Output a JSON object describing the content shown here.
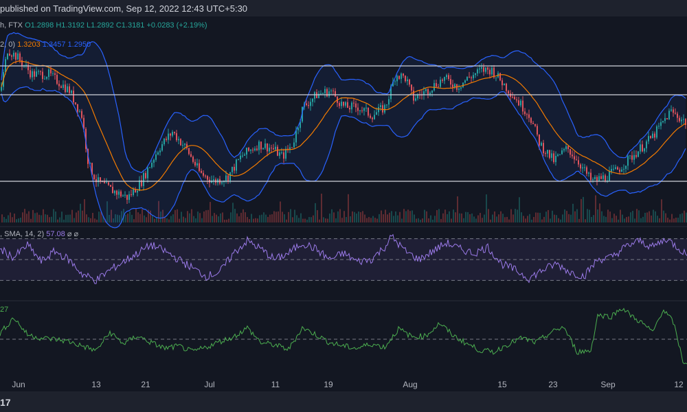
{
  "header": {
    "published_text": "published on TradingView.com, Sep 12, 2022 12:43 UTC+5:30"
  },
  "main_legend": {
    "prefix": "h, FTX",
    "o": "O1.2898",
    "h": "H1.3192",
    "l": "L1.2892",
    "c": "C1.3181",
    "chg": "+0.0283 (+2.19%)"
  },
  "bb_legend": {
    "params": "2, 0)",
    "basis": "1.3203",
    "upper": "1.3457",
    "lower": "1.2950"
  },
  "rsi_legend": {
    "params": ", SMA, 14, 2)",
    "value": "57.08",
    "extra": "⌀  ⌀"
  },
  "third_legend": {
    "value": "27"
  },
  "x_axis": {
    "labels": [
      "Jun",
      "13",
      "21",
      "Jul",
      "11",
      "19",
      "Aug",
      "15",
      "23",
      "Sep",
      "12"
    ]
  },
  "footer": {
    "logo": "17"
  },
  "colors": {
    "up": "#26a69a",
    "down": "#ef5350",
    "bb_band": "#2962ff",
    "bb_basis": "#f57c00",
    "rsi": "#9c7bea",
    "third": "#4caf50",
    "hline": "#d1d4dc"
  },
  "chart_data": [
    {
      "type": "candlestick",
      "title": "",
      "indicators": [
        "Bollinger Bands",
        "Volume"
      ],
      "price_path": [
        [
          0,
          1.31
        ],
        [
          10,
          1.36
        ],
        [
          25,
          1.35
        ],
        [
          45,
          1.33
        ],
        [
          70,
          1.33
        ],
        [
          100,
          1.31
        ],
        [
          118,
          1.28
        ],
        [
          128,
          1.22
        ],
        [
          140,
          1.2
        ],
        [
          160,
          1.19
        ],
        [
          185,
          1.18
        ],
        [
          205,
          1.2
        ],
        [
          230,
          1.24
        ],
        [
          250,
          1.26
        ],
        [
          270,
          1.24
        ],
        [
          290,
          1.21
        ],
        [
          310,
          1.2
        ],
        [
          330,
          1.205
        ],
        [
          350,
          1.23
        ],
        [
          375,
          1.245
        ],
        [
          395,
          1.24
        ],
        [
          410,
          1.23
        ],
        [
          425,
          1.245
        ],
        [
          440,
          1.29
        ],
        [
          460,
          1.305
        ],
        [
          480,
          1.31
        ],
        [
          500,
          1.29
        ],
        [
          520,
          1.29
        ],
        [
          540,
          1.28
        ],
        [
          560,
          1.29
        ],
        [
          575,
          1.33
        ],
        [
          590,
          1.325
        ],
        [
          600,
          1.3
        ],
        [
          620,
          1.31
        ],
        [
          645,
          1.325
        ],
        [
          665,
          1.315
        ],
        [
          680,
          1.325
        ],
        [
          700,
          1.335
        ],
        [
          715,
          1.335
        ],
        [
          730,
          1.32
        ],
        [
          750,
          1.3
        ],
        [
          770,
          1.28
        ],
        [
          785,
          1.245
        ],
        [
          805,
          1.225
        ],
        [
          825,
          1.24
        ],
        [
          840,
          1.225
        ],
        [
          860,
          1.2
        ],
        [
          880,
          1.205
        ],
        [
          900,
          1.215
        ],
        [
          925,
          1.235
        ],
        [
          950,
          1.255
        ],
        [
          975,
          1.285
        ],
        [
          1000,
          1.27
        ]
      ],
      "horizontal_lines": [
        1.34,
        1.305,
        1.2
      ]
    },
    {
      "type": "line",
      "title": "RSI",
      "value": 57.08,
      "levels": [
        70,
        50,
        30
      ],
      "values_path": [
        [
          0,
          60
        ],
        [
          20,
          52
        ],
        [
          40,
          64
        ],
        [
          60,
          48
        ],
        [
          80,
          58
        ],
        [
          100,
          50
        ],
        [
          120,
          36
        ],
        [
          140,
          30
        ],
        [
          160,
          40
        ],
        [
          180,
          48
        ],
        [
          200,
          56
        ],
        [
          220,
          64
        ],
        [
          240,
          58
        ],
        [
          260,
          50
        ],
        [
          280,
          42
        ],
        [
          300,
          34
        ],
        [
          320,
          38
        ],
        [
          340,
          56
        ],
        [
          360,
          68
        ],
        [
          380,
          60
        ],
        [
          400,
          50
        ],
        [
          420,
          56
        ],
        [
          440,
          66
        ],
        [
          460,
          60
        ],
        [
          480,
          50
        ],
        [
          500,
          56
        ],
        [
          520,
          48
        ],
        [
          540,
          50
        ],
        [
          560,
          62
        ],
        [
          570,
          72
        ],
        [
          590,
          58
        ],
        [
          610,
          50
        ],
        [
          630,
          58
        ],
        [
          650,
          66
        ],
        [
          670,
          60
        ],
        [
          690,
          56
        ],
        [
          710,
          62
        ],
        [
          730,
          46
        ],
        [
          750,
          40
        ],
        [
          770,
          32
        ],
        [
          790,
          40
        ],
        [
          810,
          46
        ],
        [
          830,
          38
        ],
        [
          850,
          34
        ],
        [
          870,
          50
        ],
        [
          890,
          52
        ],
        [
          910,
          62
        ],
        [
          930,
          68
        ],
        [
          950,
          62
        ],
        [
          970,
          70
        ],
        [
          990,
          60
        ],
        [
          1000,
          54
        ]
      ]
    },
    {
      "type": "line",
      "title": "",
      "value": 27,
      "reference_level": 0,
      "values_path": [
        [
          0,
          10
        ],
        [
          20,
          38
        ],
        [
          40,
          8
        ],
        [
          60,
          2
        ],
        [
          80,
          0
        ],
        [
          100,
          -4
        ],
        [
          120,
          -12
        ],
        [
          140,
          -20
        ],
        [
          160,
          12
        ],
        [
          180,
          -8
        ],
        [
          200,
          6
        ],
        [
          220,
          -6
        ],
        [
          240,
          -16
        ],
        [
          260,
          -12
        ],
        [
          280,
          -22
        ],
        [
          300,
          -14
        ],
        [
          320,
          -4
        ],
        [
          340,
          4
        ],
        [
          360,
          20
        ],
        [
          380,
          -6
        ],
        [
          400,
          -10
        ],
        [
          420,
          -18
        ],
        [
          440,
          20
        ],
        [
          460,
          8
        ],
        [
          480,
          -6
        ],
        [
          500,
          -12
        ],
        [
          520,
          -16
        ],
        [
          540,
          -8
        ],
        [
          560,
          -14
        ],
        [
          580,
          18
        ],
        [
          600,
          4
        ],
        [
          620,
          6
        ],
        [
          640,
          28
        ],
        [
          660,
          6
        ],
        [
          680,
          -8
        ],
        [
          700,
          -20
        ],
        [
          720,
          -22
        ],
        [
          740,
          -8
        ],
        [
          760,
          2
        ],
        [
          780,
          -6
        ],
        [
          800,
          10
        ],
        [
          820,
          22
        ],
        [
          840,
          -22
        ],
        [
          860,
          -20
        ],
        [
          870,
          42
        ],
        [
          890,
          40
        ],
        [
          905,
          55
        ],
        [
          920,
          40
        ],
        [
          935,
          28
        ],
        [
          950,
          12
        ],
        [
          965,
          52
        ],
        [
          980,
          30
        ],
        [
          995,
          -42
        ],
        [
          1000,
          -40
        ]
      ]
    }
  ]
}
